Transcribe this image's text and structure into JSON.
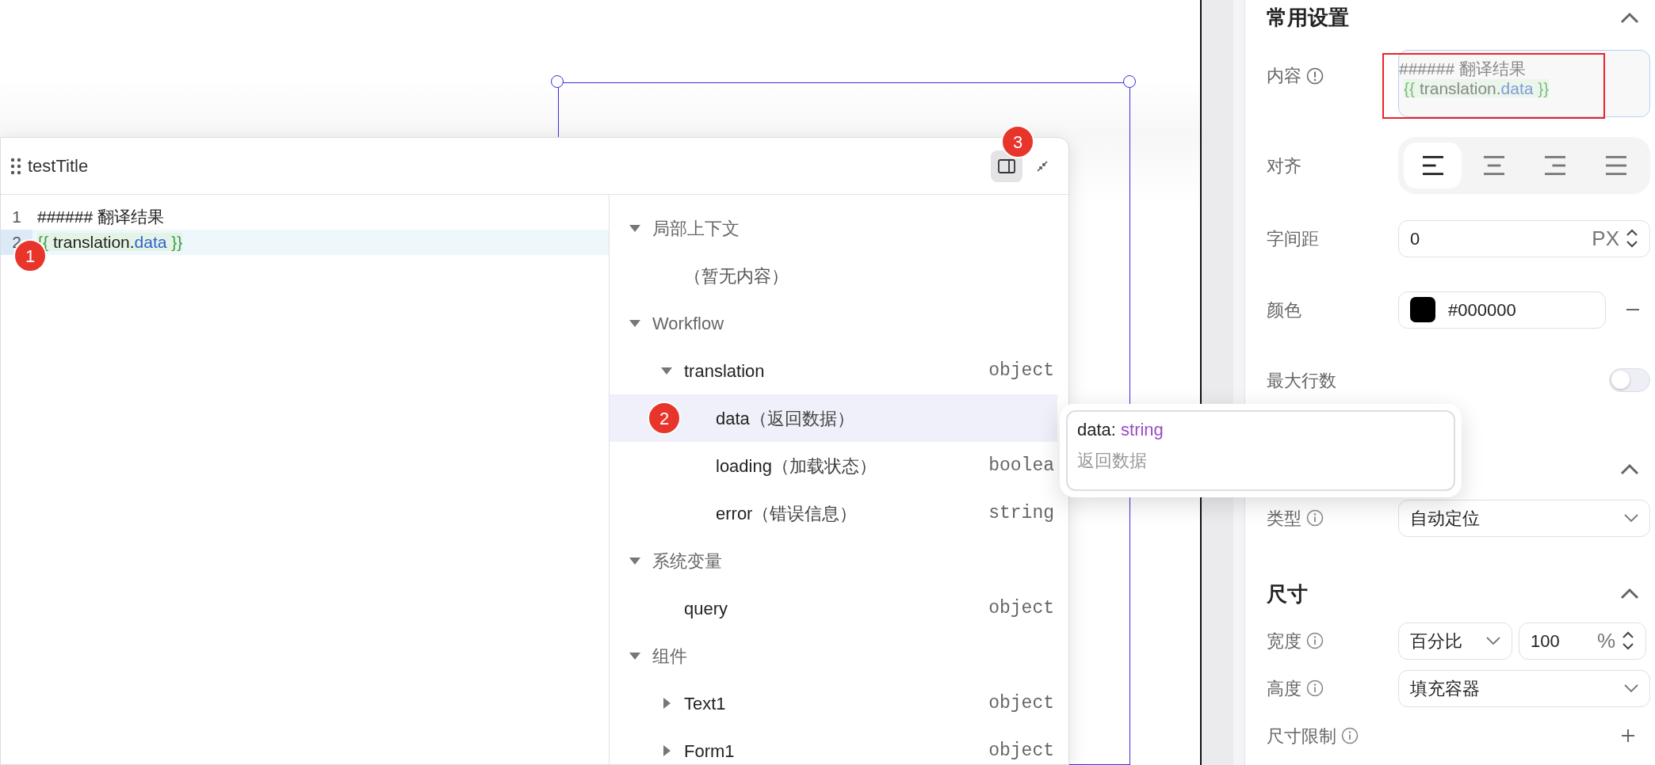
{
  "canvas": {
    "selected_component": {
      "selected": true
    }
  },
  "editor_popup": {
    "title": "testTitle",
    "badge": "3",
    "code_lines": [
      {
        "number": "1",
        "active": false,
        "template": false,
        "segments": [
          {
            "kind": "plain",
            "text": "###### 翻译结果"
          }
        ]
      },
      {
        "number": "2",
        "active": true,
        "template": true,
        "badge": "1",
        "segments": [
          {
            "kind": "brace",
            "text": "{{ "
          },
          {
            "kind": "plain",
            "text": "translation."
          },
          {
            "kind": "property",
            "text": "data"
          },
          {
            "kind": "brace",
            "text": " }}"
          }
        ]
      }
    ],
    "tree": [
      {
        "label": "局部上下文",
        "expanded": true,
        "empty_text": "（暂无内容）"
      },
      {
        "label": "Workflow",
        "expanded": true,
        "children": [
          {
            "label": "translation",
            "type": "object",
            "expanded": true,
            "children": [
              {
                "label": "data",
                "note": "（返回数据）",
                "selected": true,
                "badge": "2"
              },
              {
                "label": "loading",
                "note": "（加载状态）",
                "type": "boolea",
                "selected": false
              },
              {
                "label": "error",
                "note": "（错误信息）",
                "type": "string",
                "selected": false
              }
            ]
          }
        ]
      },
      {
        "label": "系统变量",
        "expanded": true,
        "children": [
          {
            "label": "query",
            "type": "object"
          }
        ]
      },
      {
        "label": "组件",
        "expanded": true,
        "children": [
          {
            "label": "Text1",
            "type": "object",
            "expanded": false
          },
          {
            "label": "Form1",
            "type": "object",
            "expanded": false
          }
        ]
      }
    ]
  },
  "tooltip": {
    "name": "data:",
    "type": "string",
    "description": "返回数据"
  },
  "properties": [
    {
      "title": "常用设置",
      "expanded": true,
      "rows": [
        {
          "kind": "textarea",
          "label": "内容",
          "annotated": true,
          "lines": [
            {
              "template": false,
              "segments": [
                {
                  "kind": "plain",
                  "text": "###### 翻译结果"
                }
              ]
            },
            {
              "template": true,
              "segments": [
                {
                  "kind": "brace",
                  "text": "{{ "
                },
                {
                  "kind": "plain",
                  "text": "translation."
                },
                {
                  "kind": "property",
                  "text": "data"
                },
                {
                  "kind": "brace",
                  "text": " }}"
                }
              ]
            }
          ]
        },
        {
          "kind": "segmented",
          "label": "对齐",
          "options": [
            {
              "selected": true
            },
            {
              "selected": false
            },
            {
              "selected": false
            },
            {
              "selected": false
            }
          ]
        },
        {
          "kind": "number",
          "label": "字间距",
          "value": "0",
          "unit": "PX"
        },
        {
          "kind": "color",
          "label": "颜色",
          "color": "#000000",
          "value": "#000000"
        },
        {
          "kind": "toggle",
          "label": "最大行数",
          "on": false
        }
      ]
    },
    {
      "expanded": true,
      "rows": [
        {
          "kind": "select",
          "label": "类型",
          "value": "自动定位"
        }
      ]
    },
    {
      "title": "尺寸",
      "expanded": true,
      "rows": [
        {
          "kind": "select_number",
          "label": "宽度",
          "select": "百分比",
          "value": "100",
          "unit": "%"
        },
        {
          "kind": "select",
          "label": "高度",
          "value": "填充容器"
        },
        {
          "kind": "add",
          "label": "尺寸限制"
        }
      ]
    }
  ]
}
